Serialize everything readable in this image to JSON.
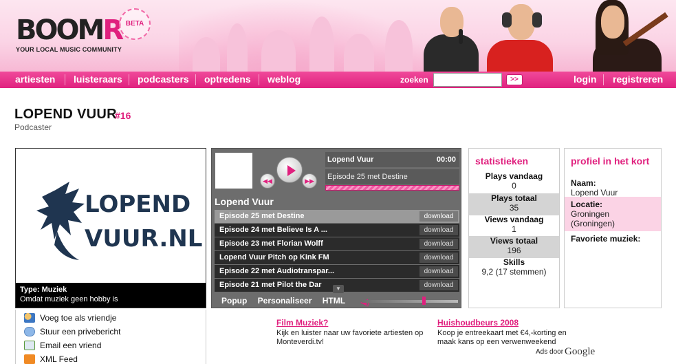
{
  "brand": {
    "logo_main": "BOOM",
    "logo_accent": "R",
    "badge": "BETA",
    "tagline": "YOUR LOCAL MUSIC COMMUNITY",
    "accent_color": "#e0207e"
  },
  "nav": {
    "items": [
      "artiesten",
      "luisteraars",
      "podcasters",
      "optredens",
      "weblog"
    ],
    "search_label": "zoeken",
    "search_value": "",
    "search_button": ">>",
    "login": "login",
    "register": "registreren"
  },
  "page": {
    "title": "LOPEND VUUR",
    "rank": "#16",
    "subtitle": "Podcaster"
  },
  "artwork": {
    "logo_line1": "LOPEND",
    "logo_line2": "VUUR.NL",
    "caption_type": "Type: Muziek",
    "caption_desc": "Omdat muziek geen hobby is"
  },
  "actions": [
    {
      "label": "Voeg toe als vriendje",
      "icon": "add-friend-icon"
    },
    {
      "label": "Stuur een privebericht",
      "icon": "message-icon"
    },
    {
      "label": "Email een vriend",
      "icon": "email-icon"
    },
    {
      "label": "XML Feed",
      "icon": "rss-feed-icon"
    }
  ],
  "player": {
    "now_artist": "Lopend Vuur",
    "time": "00:00",
    "now_track": "Episode 25 met Destine",
    "playlist_title": "Lopend Vuur",
    "tracks": [
      {
        "title": "Episode 25 met Destine",
        "action": "download"
      },
      {
        "title": "Episode 24 met Believe Is A ...",
        "action": "download"
      },
      {
        "title": "Episode 23 met Florian Wolff",
        "action": "download"
      },
      {
        "title": "Lopend Vuur Pitch op Kink FM",
        "action": "download"
      },
      {
        "title": "Episode 22 met Audiotranspar...",
        "action": "download"
      },
      {
        "title": "Episode 21 met Pilot the Dar",
        "action": "download"
      }
    ],
    "footer": [
      "Popup",
      "Personaliseer",
      "HTML"
    ],
    "volume": 0.65
  },
  "stats": {
    "title": "statistieken",
    "rows": [
      {
        "label": "Plays vandaag",
        "value": "0"
      },
      {
        "label": "Plays totaal",
        "value": "35"
      },
      {
        "label": "Views vandaag",
        "value": "1"
      },
      {
        "label": "Views totaal",
        "value": "196"
      },
      {
        "label": "Skills",
        "value": "9,2 (17 stemmen)"
      }
    ]
  },
  "profile": {
    "title": "profiel in het kort",
    "name_label": "Naam:",
    "name_value": "Lopend Vuur",
    "location_label": "Locatie:",
    "location_value": "Groningen (Groningen)",
    "music_label": "Favoriete muziek:"
  },
  "ads": [
    {
      "title": "Film Muziek?",
      "text": "Kijk en luister naar uw favoriete artiesten op Monteverdi.tv!"
    },
    {
      "title": "Huishoudbeurs 2008",
      "text": "Koop je entreekaart met €4,-korting en maak kans op een verwenweekend"
    }
  ],
  "ads_by": "Ads door",
  "ads_brand": "Google"
}
